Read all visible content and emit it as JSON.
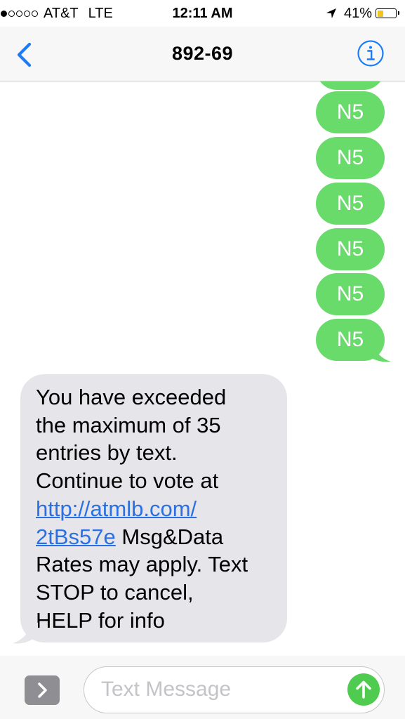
{
  "status_bar": {
    "carrier": "AT&T",
    "network": "LTE",
    "time": "12:11 AM",
    "battery_percent": "41%",
    "battery_level": 0.41,
    "battery_color": "#f2c41e",
    "signal_bars_filled": 1,
    "signal_bars_total": 5,
    "icons": [
      "signal-dots-icon",
      "location-arrow-icon",
      "battery-icon"
    ]
  },
  "nav_bar": {
    "title": "892-69",
    "back_icon": "chevron-left-icon",
    "info_icon": "info-circle-icon",
    "accent_color": "#1b7cf5"
  },
  "conversation": {
    "sent_messages": [
      "N5",
      "N5",
      "N5",
      "N5",
      "N5",
      "N5"
    ],
    "sent_bubble_color": "#68db6b",
    "received_bubble_color": "#e5e5ea",
    "received_message": {
      "lines": [
        "You have exceeded",
        "the maximum of 35",
        "entries by text.",
        "Continue to vote at"
      ],
      "link_line_1": "http://atmlb.com/",
      "link_line_2": "2tBs57e",
      "after_link": " Msg&Data",
      "tail_lines": [
        "Rates may apply. Text",
        "STOP to cancel,",
        "HELP for info"
      ],
      "link_color": "#2b70e2"
    }
  },
  "input_bar": {
    "placeholder": "Text Message",
    "apps_icon": "chevron-right-icon",
    "send_icon": "arrow-up-icon",
    "send_color": "#4fcb50"
  }
}
